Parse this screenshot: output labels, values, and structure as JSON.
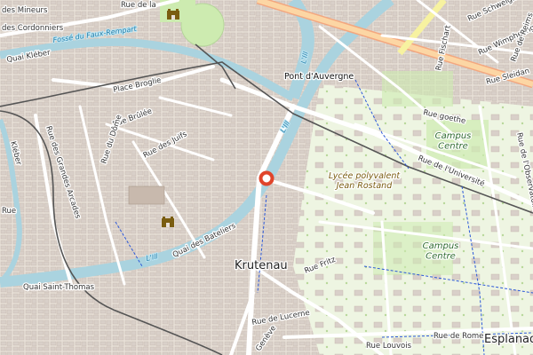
{
  "map": {
    "labels": {
      "quai_des_mineurs": "des Mineurs",
      "rue_de_la_1": "Rue de la",
      "quai_kleber": "Quai Kléber",
      "fosse_faux_rempart": "Fossé du Faux-Rempart",
      "place_broglie": "Place Broglie",
      "rue_brulee": "Rue Brûlée",
      "rue_du_dome": "Rue du Dôme",
      "rue_des_grandes_arcades": "Rue des Grandes Arcades",
      "rue_des_juifs": "Rue des Juifs",
      "rue_kleber_short": "Kléber",
      "rue_short": "Rue",
      "quai_saint_thomas": "Quai Saint-Thomas",
      "quai_des_bateliers": "Quai des Bateliers",
      "ill_west": "L'Ill",
      "ill_center": "L'Ill",
      "ill_north": "L'Ill",
      "pont_dauvergne": "Pont d'Auvergne",
      "krutenau": "Krutenau",
      "rue_fritz": "Rue Fritz",
      "rue_de_lucerne": "Rue de Lucerne",
      "rue_geneve": "Genève",
      "rue_louvois": "Rue Louvois",
      "rue_de_rome": "Rue de Rome",
      "esplanade": "Esplanad",
      "campus_centre_1": "Campus\nCentre",
      "campus_centre_2": "Campus\nCentre",
      "lycee": "Lycée polyvalent\nJean Rostand",
      "rue_goethe": "Rue goethe",
      "rue_universite": "Rue de l'Université",
      "rue_observatoire": "Rue de l'Observatoire",
      "rue_fischart": "Rue Fischart",
      "rue_schweighaeuser": "Rue Schweighaeuser",
      "rue_wimpheling": "Rue Wimpheling",
      "rue_de_reims": "Rue de Reims",
      "rue_sleidan": "Rue Sleidan",
      "rue_des_cordonniers": "des Cordonniers"
    },
    "marker": {
      "name": "location-pin",
      "color": "#e0452b"
    },
    "colors": {
      "background": "#f2efe9",
      "water": "#aad3df",
      "water_edge": "#7fbfd6",
      "building": "#d9d0c9",
      "building_edge": "#c4b6ab",
      "green": "#cdebb0",
      "primary_road": "#fcd6a4",
      "trunk_road": "#f9b29c",
      "tertiary_road": "#ffffff",
      "road_outline": "#cfc6bb",
      "tram": "#555555",
      "cycleway": "#2b58d8",
      "campus_green": "#e6f4d6"
    }
  }
}
